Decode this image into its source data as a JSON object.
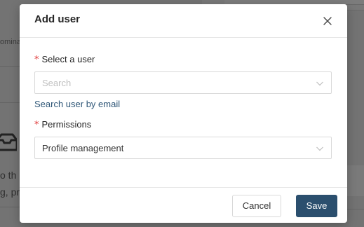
{
  "background": {
    "tab_text": "omina",
    "text_line_1": "o th",
    "text_line_2": "g, pr"
  },
  "modal": {
    "title": "Add user",
    "close_icon": "close-icon",
    "user_field": {
      "required_mark": "*",
      "label": "Select a user",
      "placeholder": "Search",
      "dropdown_icon": "chevron-down-icon"
    },
    "email_link": "Search user by email",
    "permissions_field": {
      "required_mark": "*",
      "label": "Permissions",
      "value": "Profile management",
      "dropdown_icon": "chevron-down-icon"
    },
    "footer": {
      "cancel_label": "Cancel",
      "save_label": "Save"
    }
  },
  "colors": {
    "overlay": "#737373",
    "primary_button": "#2b4f6e",
    "link": "#2d5576",
    "required": "#e03b3b"
  }
}
